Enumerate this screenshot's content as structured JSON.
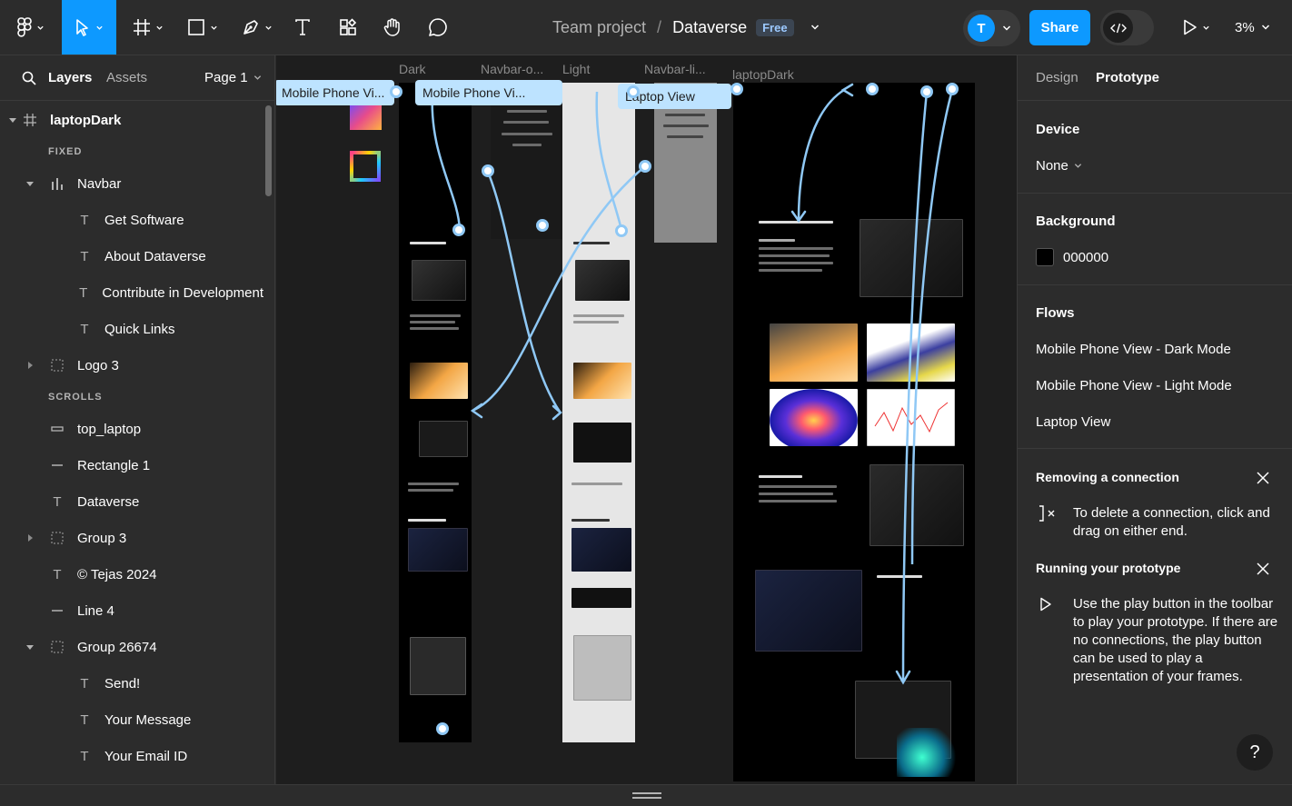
{
  "toolbar": {
    "tools": [
      "figma-menu",
      "move",
      "frame",
      "shape",
      "pen",
      "text",
      "resources",
      "hand",
      "comment"
    ],
    "breadcrumb": {
      "project": "Team project",
      "separator": "/",
      "file": "Dataverse",
      "plan_badge": "Free"
    },
    "avatar_initial": "T",
    "share_label": "Share",
    "zoom": "3%"
  },
  "left_panel": {
    "tabs": {
      "layers": "Layers",
      "assets": "Assets"
    },
    "page": "Page 1",
    "root_frame": "laptopDark",
    "section_fixed": "FIXED",
    "section_scrolls": "SCROLLS",
    "layers": [
      {
        "name": "Navbar",
        "icon": "bar-chart-icon"
      },
      {
        "name": "Get Software",
        "icon": "text-icon"
      },
      {
        "name": "About Dataverse",
        "icon": "text-icon"
      },
      {
        "name": "Contribute in Development",
        "icon": "text-icon"
      },
      {
        "name": "Quick Links",
        "icon": "text-icon"
      },
      {
        "name": "Logo 3",
        "icon": "group-icon"
      },
      {
        "name": "top_laptop",
        "icon": "rectangle-icon"
      },
      {
        "name": "Rectangle 1",
        "icon": "line-icon"
      },
      {
        "name": "Dataverse",
        "icon": "text-icon"
      },
      {
        "name": "Group 3",
        "icon": "group-icon"
      },
      {
        "name": "© Tejas 2024",
        "icon": "text-icon"
      },
      {
        "name": "Line 4",
        "icon": "line-icon"
      },
      {
        "name": "Group 26674",
        "icon": "group-icon"
      },
      {
        "name": "Send!",
        "icon": "text-icon"
      },
      {
        "name": "Your Message",
        "icon": "text-icon"
      },
      {
        "name": "Your Email ID",
        "icon": "text-icon"
      }
    ]
  },
  "canvas": {
    "frame_labels": [
      "Dark",
      "Navbar-o...",
      "Light",
      "Navbar-li...",
      "laptopDark"
    ],
    "flow_tags": [
      "Mobile Phone Vi...",
      "Mobile Phone Vi...",
      "Laptop View"
    ]
  },
  "right_panel": {
    "tabs": {
      "design": "Design",
      "prototype": "Prototype"
    },
    "device_title": "Device",
    "device_value": "None",
    "background_title": "Background",
    "background_hex": "000000",
    "flows_title": "Flows",
    "flows": [
      "Mobile Phone View - Dark Mode",
      "Mobile Phone View - Light Mode",
      "Laptop View"
    ],
    "tip1_title": "Removing a connection",
    "tip1_text": "To delete a connection, click and drag on either end.",
    "tip2_title": "Running your prototype",
    "tip2_text": "Use the play button in the toolbar to play your prototype. If there are no connections, the play button can be used to play a presentation of your frames.",
    "help": "?"
  },
  "colors": {
    "accent": "#0d99ff",
    "panel": "#2c2c2c",
    "canvas": "#1e1e1e",
    "connector": "#8fc8f5",
    "flow_tag": "#bde3ff"
  }
}
